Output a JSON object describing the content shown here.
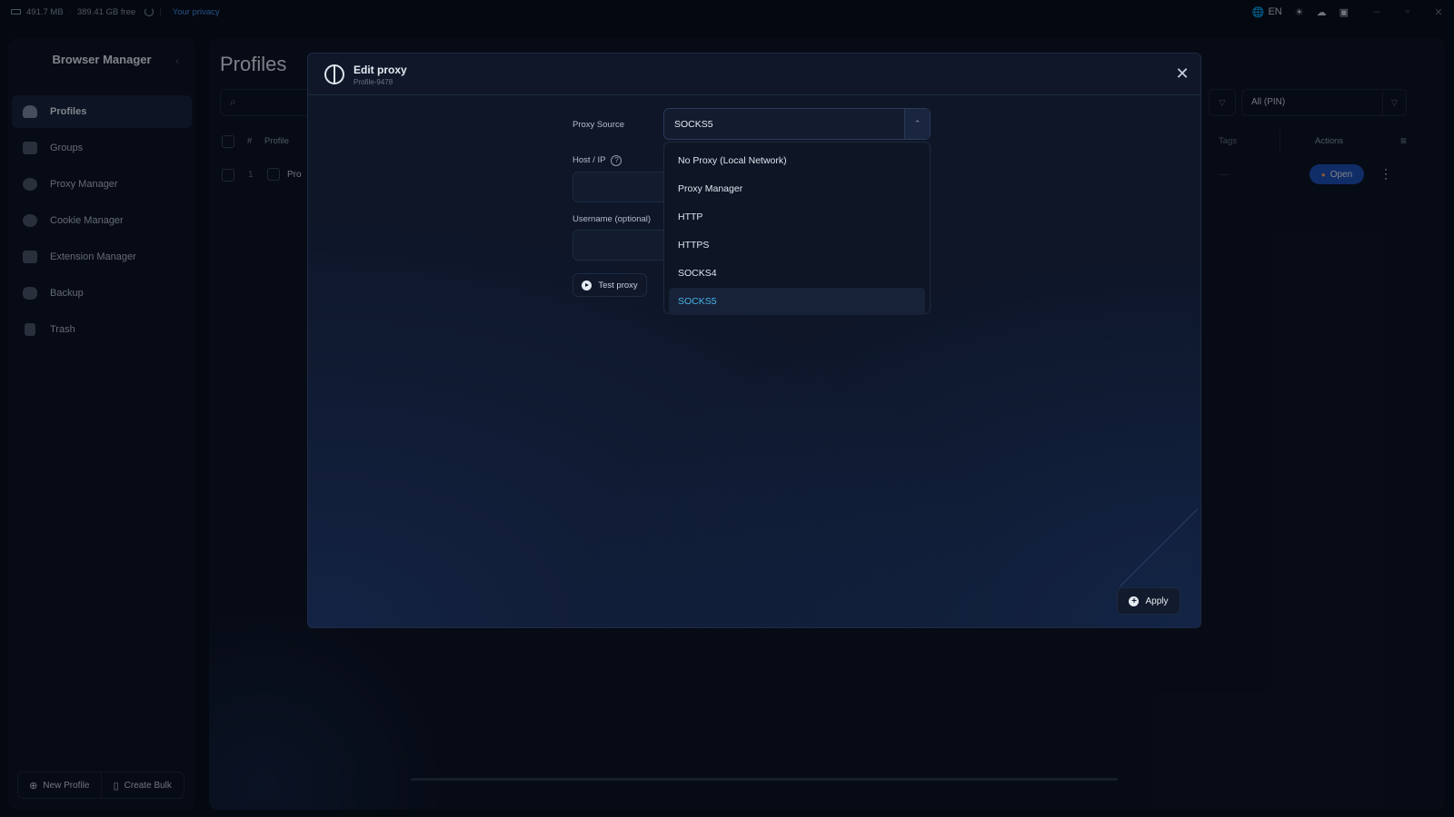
{
  "topbar": {
    "ram": "491.7 MB",
    "disk": "389.41 GB free",
    "privacy_link": "Your privacy",
    "language": "EN"
  },
  "sidebar": {
    "brand": "Browser Manager",
    "items": [
      {
        "label": "Profiles",
        "icon": "user-icon",
        "active": true
      },
      {
        "label": "Groups",
        "icon": "users-icon"
      },
      {
        "label": "Proxy Manager",
        "icon": "globe-icon"
      },
      {
        "label": "Cookie Manager",
        "icon": "cookie-icon"
      },
      {
        "label": "Extension Manager",
        "icon": "puzzle-icon"
      },
      {
        "label": "Backup",
        "icon": "database-icon"
      },
      {
        "label": "Trash",
        "icon": "trash-icon"
      }
    ],
    "new_profile": "New Profile",
    "create_bulk": "Create Bulk"
  },
  "main": {
    "title": "Profiles",
    "filter_value": "All (PIN)",
    "table": {
      "headers": {
        "hash": "#",
        "profile": "Profile",
        "tags": "Tags",
        "actions": "Actions"
      },
      "rows": [
        {
          "num": "1",
          "name": "Pro",
          "tags": "—",
          "open": "Open"
        }
      ]
    }
  },
  "modal": {
    "title": "Edit proxy",
    "subtitle": "Profile-9478",
    "proxy_source_label": "Proxy Source",
    "proxy_source_value": "SOCKS5",
    "host_label": "Host / IP",
    "username_label": "Username (optional)",
    "test_button": "Test proxy",
    "apply_button": "Apply",
    "options": [
      "No Proxy (Local Network)",
      "Proxy Manager",
      "HTTP",
      "HTTPS",
      "SOCKS4",
      "SOCKS5"
    ],
    "selected_option": "SOCKS5"
  }
}
